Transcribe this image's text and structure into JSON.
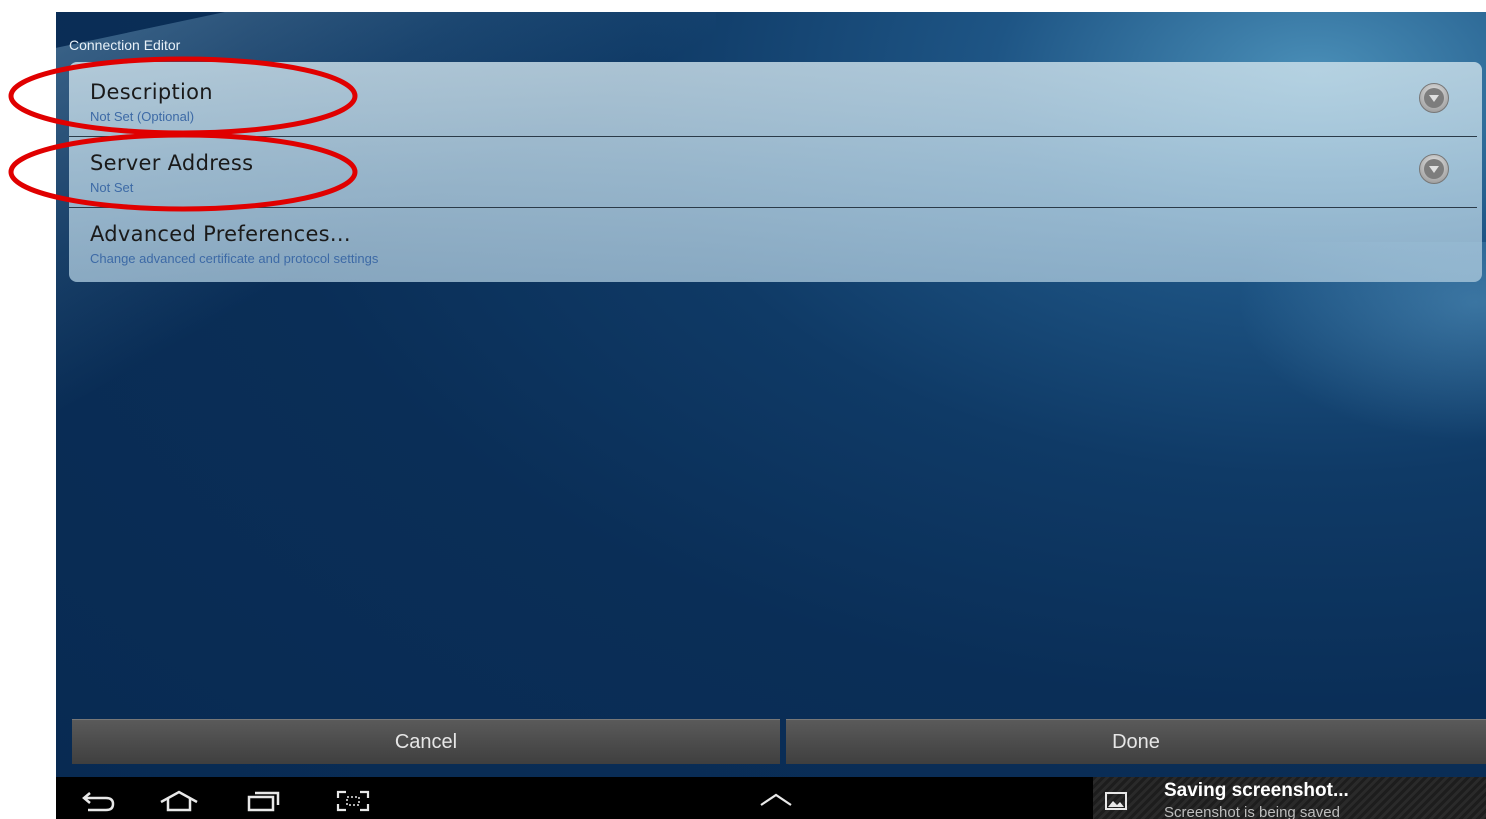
{
  "window": {
    "title": "Connection Editor"
  },
  "settings": {
    "items": [
      {
        "label": "Description",
        "sublabel": "Not Set (Optional)",
        "has_dropdown": true
      },
      {
        "label": "Server Address",
        "sublabel": "Not Set",
        "has_dropdown": true
      },
      {
        "label": "Advanced Preferences...",
        "sublabel": "Change advanced certificate and protocol settings",
        "has_dropdown": false
      }
    ],
    "dropdown_icon": "chevron-down-circle-icon"
  },
  "actions": {
    "cancel_label": "Cancel",
    "done_label": "Done"
  },
  "system_bar": {
    "icons": [
      "back-icon",
      "home-icon",
      "recent-apps-icon",
      "screenshot-icon",
      "expand-up-icon"
    ],
    "notification": {
      "icon": "image-icon",
      "title": "Saving screenshot...",
      "subtitle": "Screenshot is being saved"
    }
  },
  "annotations": {
    "highlight_color": "#e00000",
    "highlighted_items": [
      "Description",
      "Server Address"
    ]
  },
  "colors": {
    "background": "#0a2e57",
    "list_panel": "#b9d4e4",
    "sublabel": "#3d6aa6",
    "button": "#4a4a4a"
  }
}
